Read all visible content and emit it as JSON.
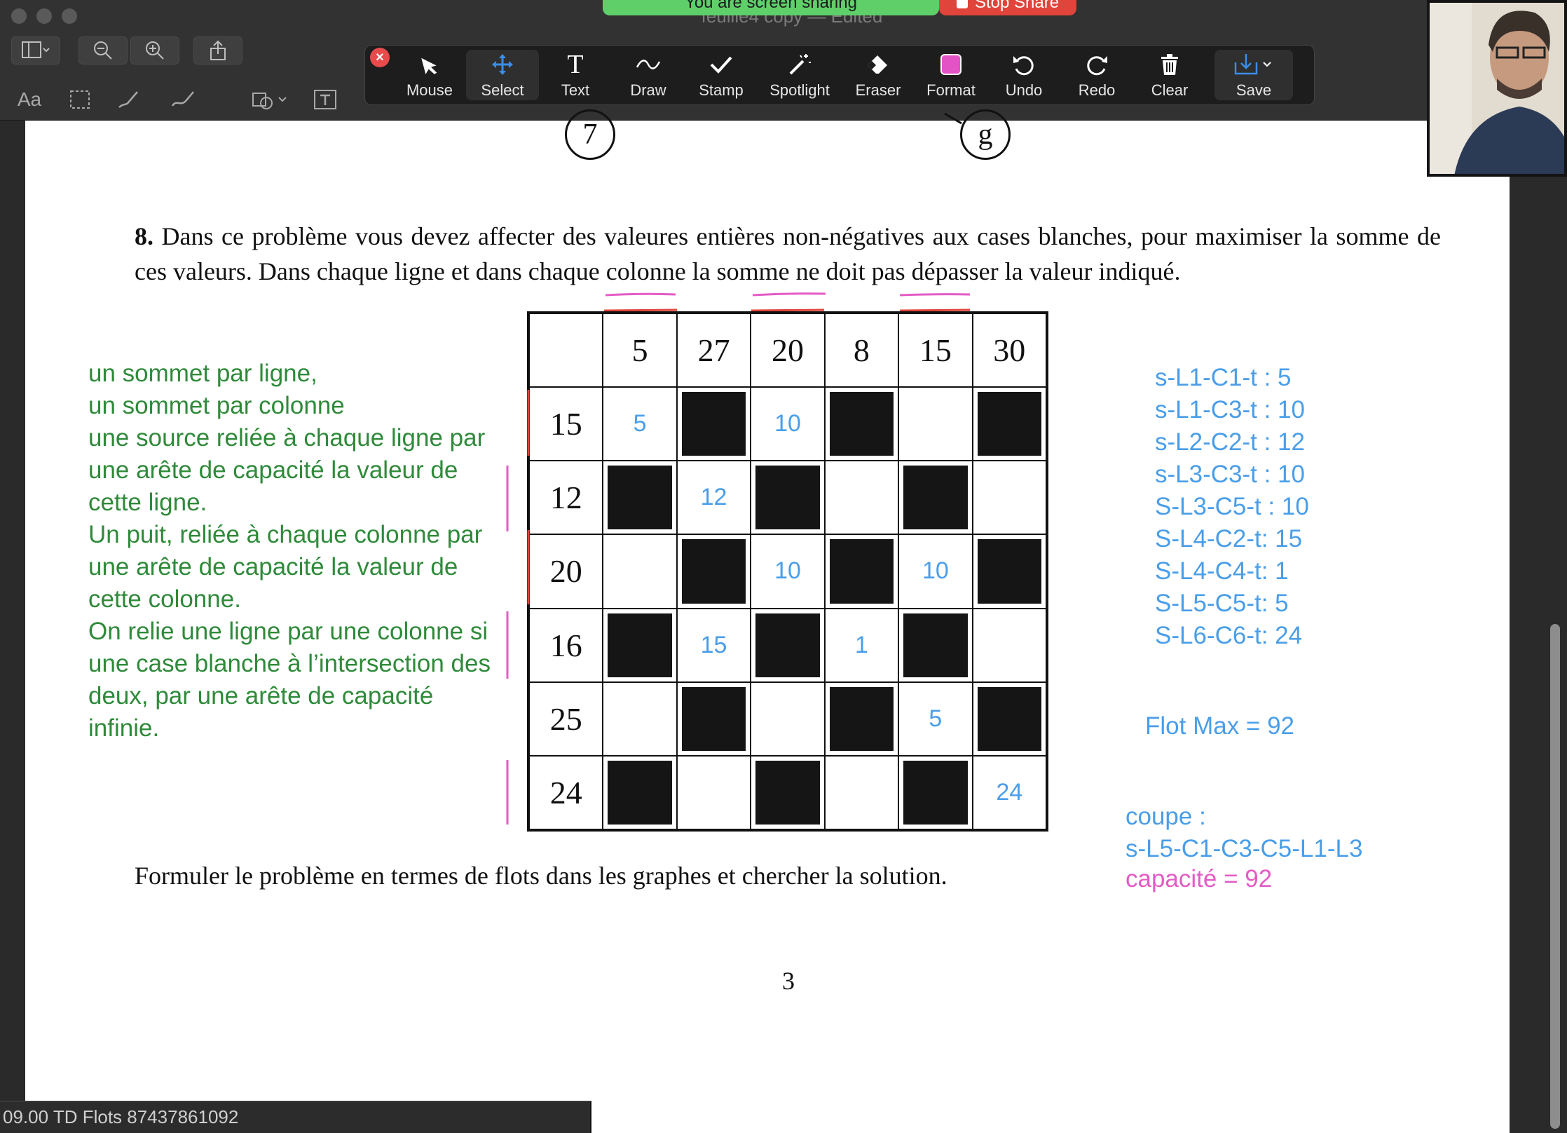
{
  "window": {
    "doc_title": "feuille4 copy — Edited"
  },
  "share": {
    "banner": "You are screen sharing",
    "stop": "Stop Share"
  },
  "toolbar": {
    "tools": [
      {
        "label": "Mouse",
        "icon": "mouse-pointer-icon"
      },
      {
        "label": "Select",
        "icon": "move-arrows-icon"
      },
      {
        "label": "Text",
        "icon": "text-t-icon"
      },
      {
        "label": "Draw",
        "icon": "squiggle-icon"
      },
      {
        "label": "Stamp",
        "icon": "checkmark-icon"
      },
      {
        "label": "Spotlight",
        "icon": "wand-icon"
      },
      {
        "label": "Eraser",
        "icon": "eraser-icon"
      },
      {
        "label": "Format",
        "icon": "color-swatch-icon"
      },
      {
        "label": "Undo",
        "icon": "undo-icon"
      },
      {
        "label": "Redo",
        "icon": "redo-icon"
      },
      {
        "label": "Clear",
        "icon": "trash-icon"
      },
      {
        "label": "Save",
        "icon": "download-icon"
      }
    ],
    "active": "Select",
    "format_color": "#e453c6"
  },
  "document": {
    "node_left": "7",
    "node_right": "g",
    "problem_number": "8.",
    "problem_text": "Dans ce problème vous devez affecter des valeures entières non-négatives aux cases blanches, pour maximiser la somme de ces valeurs. Dans chaque ligne et dans chaque colonne la somme ne doit pas dépasser la valeur indiqué.",
    "footer": "Formuler le problème en termes de flots dans les graphes et chercher la solution.",
    "page_number": "3"
  },
  "grid": {
    "col_headers": [
      "5",
      "27",
      "20",
      "8",
      "15",
      "30"
    ],
    "rows": [
      {
        "header": "15",
        "cells": [
          {
            "black": false,
            "v": "5"
          },
          {
            "black": true
          },
          {
            "black": false,
            "v": "10"
          },
          {
            "black": true
          },
          {
            "black": false
          },
          {
            "black": true
          }
        ]
      },
      {
        "header": "12",
        "cells": [
          {
            "black": true
          },
          {
            "black": false,
            "v": "12"
          },
          {
            "black": true
          },
          {
            "black": false
          },
          {
            "black": true
          },
          {
            "black": false
          }
        ]
      },
      {
        "header": "20",
        "cells": [
          {
            "black": false
          },
          {
            "black": true
          },
          {
            "black": false,
            "v": "10"
          },
          {
            "black": true
          },
          {
            "black": false,
            "v": "10"
          },
          {
            "black": true
          }
        ]
      },
      {
        "header": "16",
        "cells": [
          {
            "black": true
          },
          {
            "black": false,
            "v": "15"
          },
          {
            "black": true
          },
          {
            "black": false,
            "v": "1"
          },
          {
            "black": true
          },
          {
            "black": false
          }
        ]
      },
      {
        "header": "25",
        "cells": [
          {
            "black": false
          },
          {
            "black": true
          },
          {
            "black": false
          },
          {
            "black": true
          },
          {
            "black": false,
            "v": "5"
          },
          {
            "black": true
          }
        ]
      },
      {
        "header": "24",
        "cells": [
          {
            "black": true
          },
          {
            "black": false
          },
          {
            "black": true
          },
          {
            "black": false
          },
          {
            "black": true
          },
          {
            "black": false,
            "v": "24"
          }
        ]
      }
    ]
  },
  "notes": {
    "green": [
      "un sommet par ligne,",
      "un sommet par colonne",
      "une source reliée à chaque ligne par",
      "une arête de capacité la valeur de",
      "cette ligne.",
      "Un puit, reliée à chaque colonne par",
      "une arête de capacité la valeur de",
      "cette colonne.",
      "On relie une ligne par une colonne si",
      "une case blanche à l’intersection des",
      "deux, par une arête de capacité",
      "infinie."
    ],
    "flows": [
      "s-L1-C1-t : 5",
      "s-L1-C3-t : 10",
      "s-L2-C2-t : 12",
      "s-L3-C3-t : 10",
      "S-L3-C5-t : 10",
      "S-L4-C2-t: 15",
      "S-L4-C4-t: 1",
      "S-L5-C5-t: 5",
      "S-L6-C6-t: 24"
    ],
    "flot_max": "Flot Max = 92",
    "coupe_title": "coupe :",
    "coupe_path": "s-L5-C1-C3-C5-L1-L3",
    "capacite": "capacité = 92",
    "colors": {
      "green": "#2f8a3a",
      "blue": "#4a9ee8",
      "pink": "#e45bc6",
      "red": "#e0443a"
    }
  },
  "meeting": {
    "title": "09.00 TD Flots 87437861092"
  }
}
